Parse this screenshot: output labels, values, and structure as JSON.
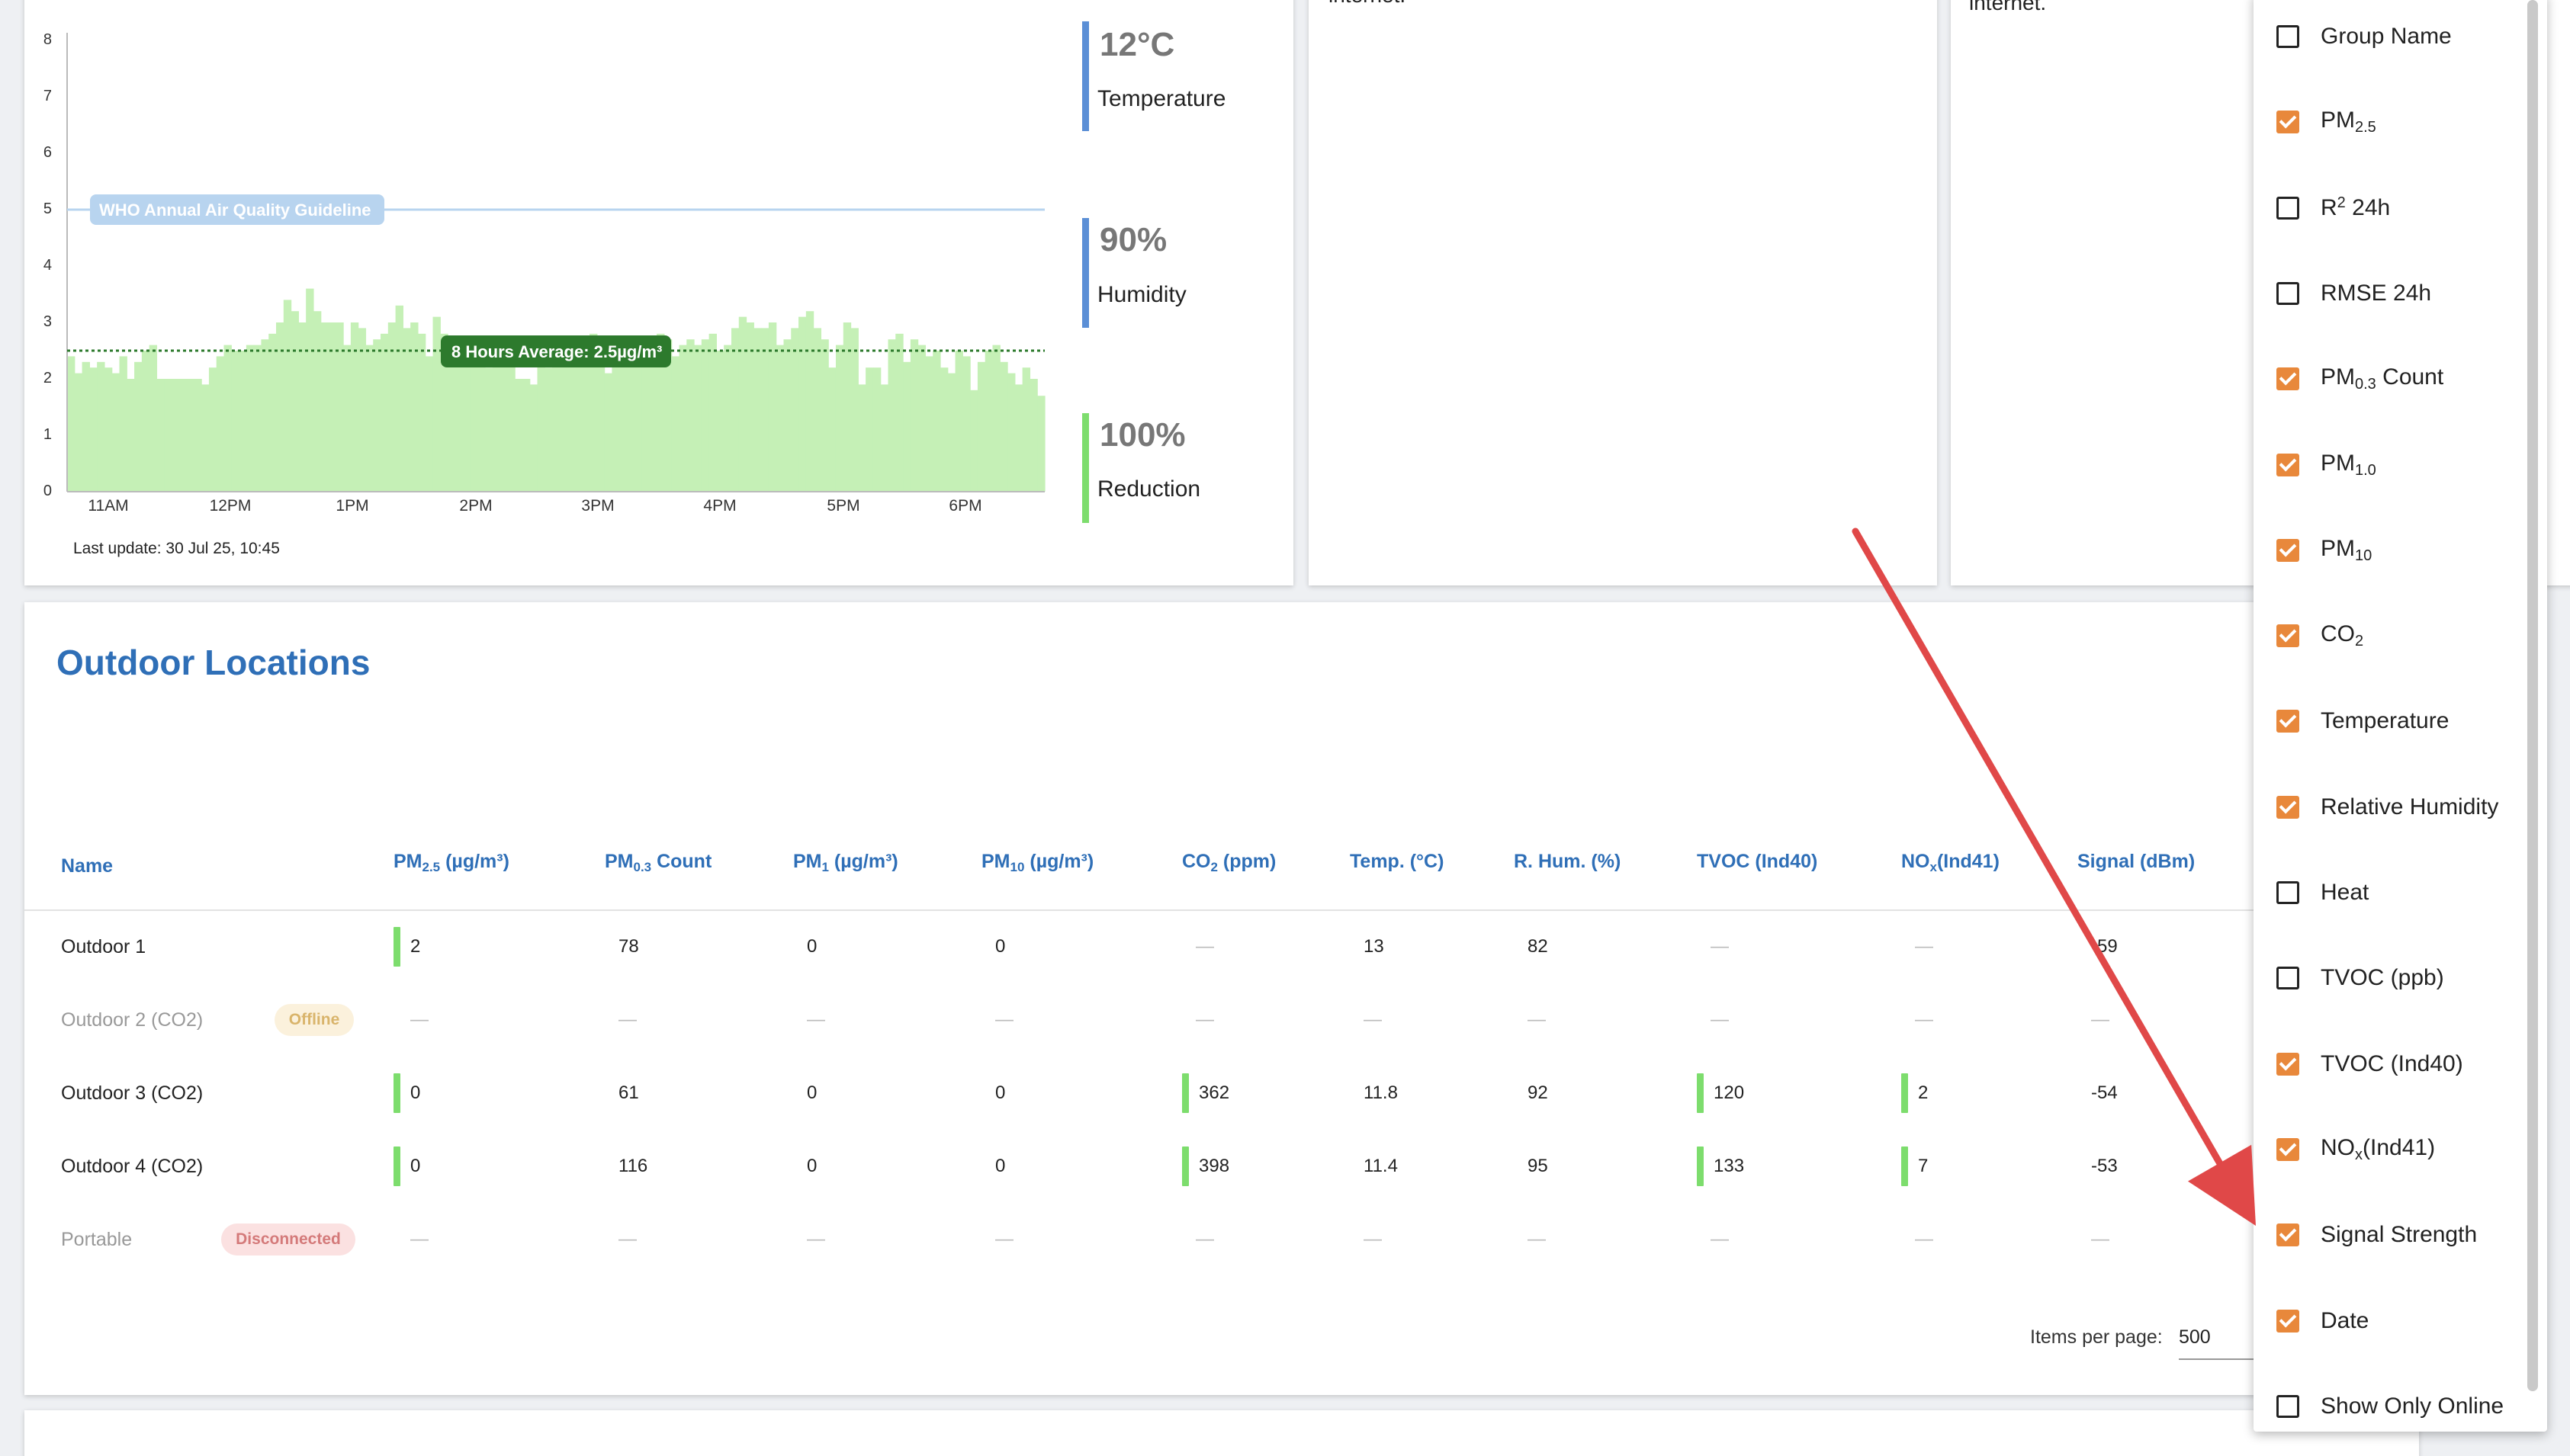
{
  "chart_card": {
    "who_label": "WHO Annual Air Quality Guideline",
    "avg_label": "8 Hours Average: 2.5µg/m³",
    "last_update": "Last update: 30 Jul 25, 10:45",
    "stats": [
      {
        "value": "12°C",
        "label": "Temperature",
        "color": "#5b8fd6"
      },
      {
        "value": "90%",
        "label": "Humidity",
        "color": "#5b8fd6"
      },
      {
        "value": "100%",
        "label": "Reduction",
        "color": "#7ddd6d"
      }
    ]
  },
  "chart_data": {
    "type": "bar",
    "y_ticks": [
      "0",
      "1",
      "2",
      "3",
      "4",
      "5",
      "6",
      "7",
      "8"
    ],
    "x_ticks": [
      "11AM",
      "12PM",
      "1PM",
      "2PM",
      "3PM",
      "4PM",
      "5PM",
      "6PM"
    ],
    "ylim": [
      0,
      8
    ],
    "who_guideline": 5,
    "average": 2.5,
    "values": [
      2.4,
      2.1,
      2.3,
      2.2,
      2.3,
      2.2,
      2.1,
      2.4,
      2.0,
      2.3,
      2.5,
      2.6,
      2.0,
      2.0,
      2.0,
      2.0,
      2.0,
      2.0,
      1.9,
      2.2,
      2.4,
      2.6,
      2.5,
      2.5,
      2.6,
      2.6,
      2.7,
      2.8,
      3.0,
      3.4,
      3.2,
      3.0,
      3.6,
      3.2,
      3.0,
      3.0,
      3.0,
      2.6,
      3.0,
      2.9,
      2.6,
      2.7,
      2.8,
      3.0,
      3.3,
      2.9,
      3.0,
      2.8,
      2.4,
      3.1,
      2.8,
      2.5,
      2.4,
      2.6,
      2.4,
      2.3,
      2.2,
      2.4,
      2.5,
      2.3,
      2.0,
      2.0,
      1.9,
      2.3,
      2.2,
      2.4,
      2.6,
      2.7,
      2.5,
      2.5,
      2.8,
      2.4,
      2.1,
      2.3,
      2.6,
      2.4,
      2.4,
      2.5,
      2.6,
      2.8,
      2.7,
      2.4,
      2.6,
      2.7,
      2.6,
      2.7,
      2.8,
      2.5,
      2.6,
      2.9,
      3.1,
      3.0,
      2.9,
      2.9,
      3.0,
      2.6,
      2.7,
      2.9,
      3.1,
      3.2,
      2.9,
      2.7,
      2.2,
      2.6,
      3.0,
      2.9,
      1.9,
      2.2,
      2.2,
      1.9,
      2.7,
      2.8,
      2.3,
      2.7,
      2.6,
      2.4,
      2.5,
      2.2,
      2.1,
      2.5,
      2.4,
      1.8,
      2.3,
      2.5,
      2.6,
      2.3,
      2.1,
      1.9,
      2.2,
      2.0,
      1.7
    ],
    "colors": {
      "bar": "#c5f0b6",
      "who_line": "#b8d4ef",
      "avg_line": "#2d7a2d"
    }
  },
  "middle_card_text": "internet.",
  "right_card_text": "internet.",
  "outdoor": {
    "title": "Outdoor Locations",
    "headers": [
      {
        "key": "name",
        "html": "Name"
      },
      {
        "key": "pm25",
        "html": "PM<sub>2.5</sub> (µg/m³)"
      },
      {
        "key": "pm03",
        "html": "PM<sub>0.3</sub> Count"
      },
      {
        "key": "pm1",
        "html": "PM<sub>1</sub> (µg/m³)"
      },
      {
        "key": "pm10",
        "html": "PM<sub>10</sub> (µg/m³)"
      },
      {
        "key": "co2",
        "html": "CO<sub>2</sub> (ppm)"
      },
      {
        "key": "temp",
        "html": "Temp. (°C)"
      },
      {
        "key": "rhum",
        "html": "R. Hum. (%)"
      },
      {
        "key": "tvoc",
        "html": "TVOC (Ind40)"
      },
      {
        "key": "nox",
        "html": "NO<sub>x</sub>(Ind41)"
      },
      {
        "key": "signal",
        "html": "Signal (dBm)"
      }
    ],
    "rows": [
      {
        "name": "Outdoor 1",
        "badge": "",
        "muted": false,
        "values": [
          "2",
          "78",
          "0",
          "0",
          "—",
          "13",
          "82",
          "—",
          "—",
          "-59"
        ],
        "indicators": [
          true,
          false,
          false,
          false,
          false,
          false,
          false,
          false,
          false,
          false
        ]
      },
      {
        "name": "Outdoor 2 (CO2)",
        "badge": "Offline",
        "badge_type": "offline",
        "muted": true,
        "values": [
          "—",
          "—",
          "—",
          "—",
          "—",
          "—",
          "—",
          "—",
          "—",
          "—"
        ],
        "indicators": [
          false,
          false,
          false,
          false,
          false,
          false,
          false,
          false,
          false,
          false
        ]
      },
      {
        "name": "Outdoor 3 (CO2)",
        "badge": "",
        "muted": false,
        "values": [
          "0",
          "61",
          "0",
          "0",
          "362",
          "11.8",
          "92",
          "120",
          "2",
          "-54"
        ],
        "indicators": [
          true,
          false,
          false,
          false,
          true,
          false,
          false,
          true,
          true,
          false
        ]
      },
      {
        "name": "Outdoor 4 (CO2)",
        "badge": "",
        "muted": false,
        "values": [
          "0",
          "116",
          "0",
          "0",
          "398",
          "11.4",
          "95",
          "133",
          "7",
          "-53"
        ],
        "indicators": [
          true,
          false,
          false,
          false,
          true,
          false,
          false,
          true,
          true,
          false
        ]
      },
      {
        "name": "Portable",
        "badge": "Disconnected",
        "badge_type": "disconnected",
        "muted": true,
        "values": [
          "—",
          "—",
          "—",
          "—",
          "—",
          "—",
          "—",
          "—",
          "—",
          "—"
        ],
        "indicators": [
          false,
          false,
          false,
          false,
          false,
          false,
          false,
          false,
          false,
          false
        ]
      }
    ],
    "pagination": {
      "label": "Items per page:",
      "value": "500"
    }
  },
  "column_menu": {
    "items": [
      {
        "html": "Group Name",
        "checked": false
      },
      {
        "html": "PM<sub>2.5</sub>",
        "checked": true
      },
      {
        "html": "R<sup>2</sup> 24h",
        "checked": false
      },
      {
        "html": "RMSE 24h",
        "checked": false
      },
      {
        "html": "PM<sub>0.3</sub> Count",
        "checked": true
      },
      {
        "html": "PM<sub>1.0</sub>",
        "checked": true
      },
      {
        "html": "PM<sub>10</sub>",
        "checked": true
      },
      {
        "html": "CO<sub>2</sub>",
        "checked": true
      },
      {
        "html": "Temperature",
        "checked": true
      },
      {
        "html": "Relative Humidity",
        "checked": true
      },
      {
        "html": "Heat",
        "checked": false
      },
      {
        "html": "TVOC (ppb)",
        "checked": false
      },
      {
        "html": "TVOC (Ind40)",
        "checked": true
      },
      {
        "html": "NO<sub>x</sub>(Ind41)",
        "checked": true
      },
      {
        "html": "Signal Strength",
        "checked": true
      },
      {
        "html": "Date",
        "checked": true
      },
      {
        "html": "Show Only Online",
        "checked": false
      }
    ],
    "accent": "#e8883b"
  },
  "annotation_arrow": {
    "color": "#e04848"
  }
}
